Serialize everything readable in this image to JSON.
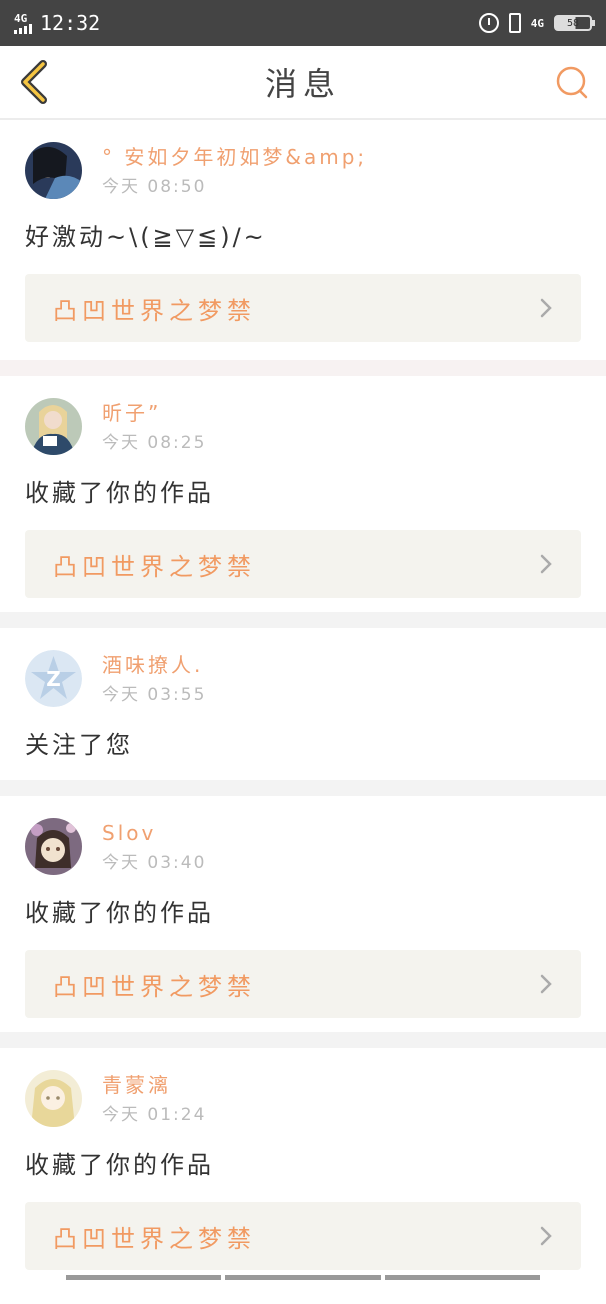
{
  "status_bar": {
    "network_left": "4G",
    "time": "12:32",
    "network_right": "4G",
    "battery": "58"
  },
  "header": {
    "title": "消息"
  },
  "messages": [
    {
      "username": "°   安如夕年初如梦&amp;",
      "time": "今天 08:50",
      "text": "好激动~\\(≧▽≦)/~",
      "work": "凸凹世界之梦禁"
    },
    {
      "username": "昕子”",
      "time": "今天 08:25",
      "text": "收藏了你的作品",
      "work": "凸凹世界之梦禁"
    },
    {
      "username": "酒味撩人.",
      "time": "今天 03:55",
      "text": "关注了您",
      "work": ""
    },
    {
      "username": "Slov",
      "time": "今天 03:40",
      "text": "收藏了你的作品",
      "work": "凸凹世界之梦禁"
    },
    {
      "username": "青蒙漓",
      "time": "今天 01:24",
      "text": "收藏了你的作品",
      "work": "凸凹世界之梦禁"
    }
  ],
  "colors": {
    "accent": "#f19a62",
    "username": "#f0a070",
    "work_bg": "#f4f3ee"
  }
}
